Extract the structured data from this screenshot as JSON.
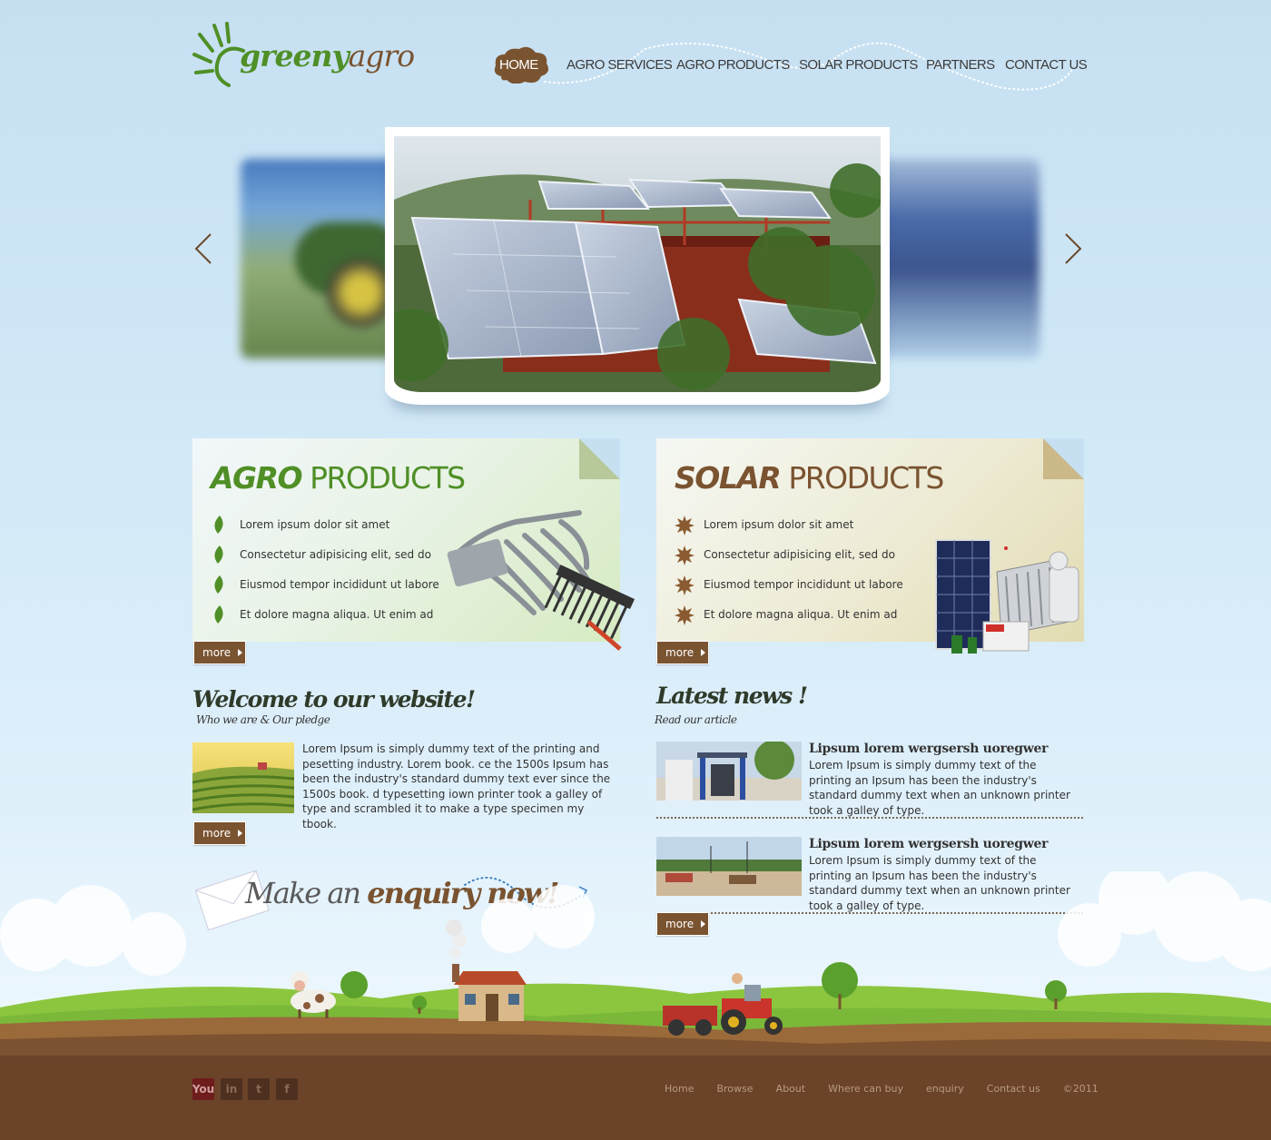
{
  "brand": {
    "name_part1": "greeny",
    "name_part2": "agro"
  },
  "nav": {
    "items": [
      "HOME",
      "AGRO SERVICES",
      "AGRO PRODUCTS",
      "SOLAR PRODUCTS",
      "PARTNERS",
      "CONTACT US"
    ],
    "active": "HOME"
  },
  "slider": {
    "prev_label": "previous slide",
    "next_label": "next slide"
  },
  "agro_products": {
    "title_bold": "AGRO",
    "title_light": "PRODUCTS",
    "items": [
      "Lorem ipsum dolor sit amet",
      "Consectetur adipisicing elit, sed do",
      "Eiusmod tempor incididunt ut labore",
      "Et dolore magna aliqua. Ut enim ad"
    ],
    "more_label": "more"
  },
  "solar_products": {
    "title_bold": "SOLAR",
    "title_light": "PRODUCTS",
    "items": [
      "Lorem ipsum dolor sit amet",
      "Consectetur adipisicing elit, sed do",
      "Eiusmod tempor incididunt ut labore",
      "Et dolore magna aliqua. Ut enim ad"
    ],
    "more_label": "more"
  },
  "welcome": {
    "title": "Welcome to our website!",
    "subtitle": "Who we are & Our pledge",
    "text": "Lorem Ipsum is simply dummy text of the printing and pesetting industry. Lorem  book. ce the 1500s Ipsum has been the industry's standard dummy text ever since the 1500s book. d typesetting iown printer took a galley of type and scrambled it to make a type specimen my tbook.",
    "more_label": "more"
  },
  "enquiry": {
    "prefix": "Make an",
    "bold": "enquiry now",
    "suffix": "!"
  },
  "news": {
    "title": "Latest news !",
    "subtitle": "Read our article",
    "items": [
      {
        "title": "Lipsum lorem wergsersh uoregwer",
        "text": "Lorem Ipsum is simply dummy text of the printing an Ipsum has been the industry's standard dummy text when an unknown printer took a galley of type."
      },
      {
        "title": "Lipsum lorem wergsersh uoregwer",
        "text": "Lorem Ipsum is simply dummy text of the printing an Ipsum has been the industry's standard dummy text when an unknown printer took a galley of type."
      }
    ],
    "more_label": "more"
  },
  "footer": {
    "social": [
      "You",
      "in",
      "t",
      "f"
    ],
    "links": [
      "Home",
      "Browse",
      "About",
      "Where can buy",
      "enquiry",
      "Contact us"
    ],
    "copyright": "©2011"
  },
  "colors": {
    "green": "#4f8f26",
    "brown": "#7a5330",
    "footer": "#6a4329"
  }
}
